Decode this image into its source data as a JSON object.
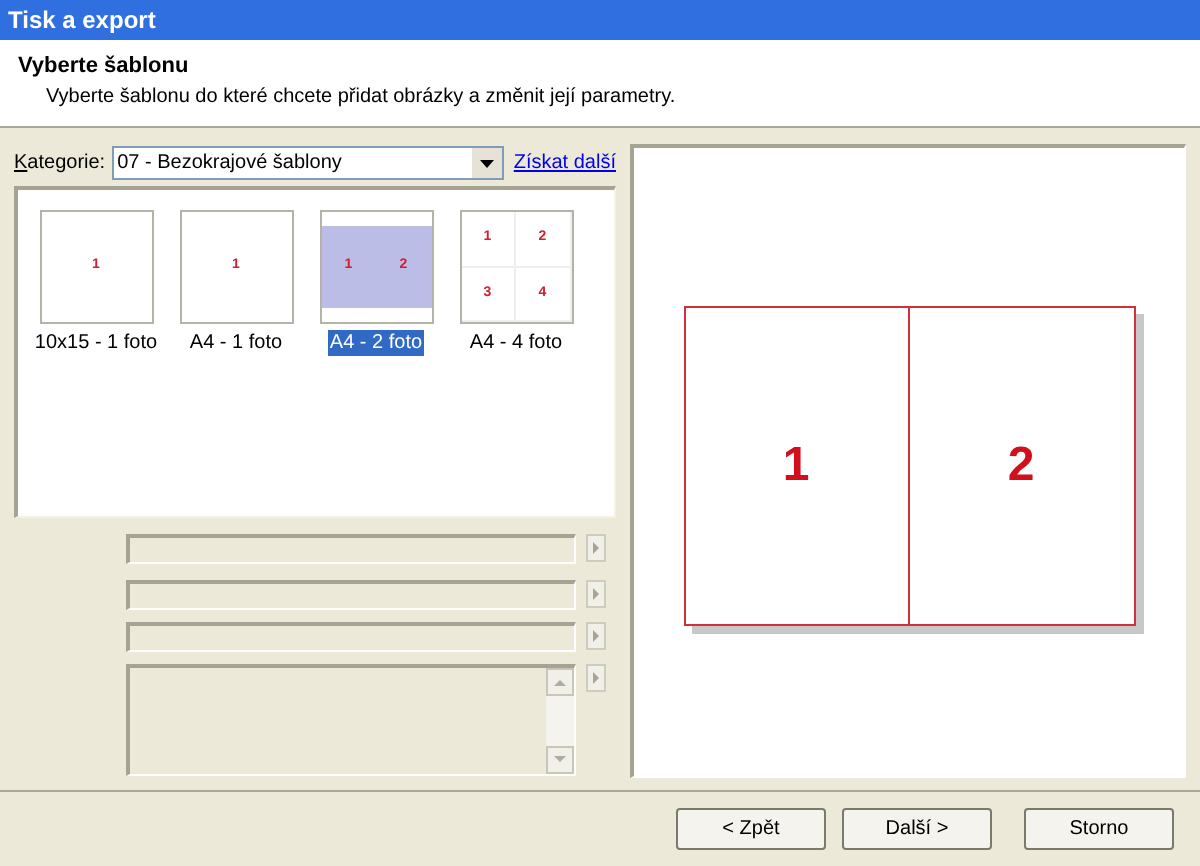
{
  "window": {
    "title": "Tisk a export"
  },
  "header": {
    "title": "Vyberte šablonu",
    "subtitle": "Vyberte šablonu do které chcete přidat obrázky a změnit její parametry."
  },
  "category": {
    "label": "Kategorie:",
    "value": "07 - Bezokrajové šablony",
    "link": "Získat další"
  },
  "templates": [
    {
      "label": "10x15 - 1 foto",
      "kind": "single",
      "slots": [
        "1"
      ],
      "selected": false
    },
    {
      "label": "A4 - 1 foto",
      "kind": "single",
      "slots": [
        "1"
      ],
      "selected": false
    },
    {
      "label": "A4 - 2 foto",
      "kind": "pair",
      "slots": [
        "1",
        "2"
      ],
      "selected": true
    },
    {
      "label": "A4 - 4 foto",
      "kind": "quad",
      "slots": [
        "1",
        "2",
        "3",
        "4"
      ],
      "selected": false
    }
  ],
  "preview": {
    "slots": [
      "1",
      "2"
    ]
  },
  "buttons": [
    {
      "label": "< Zpět"
    },
    {
      "label": "Další >"
    },
    {
      "label": "Storno"
    }
  ]
}
